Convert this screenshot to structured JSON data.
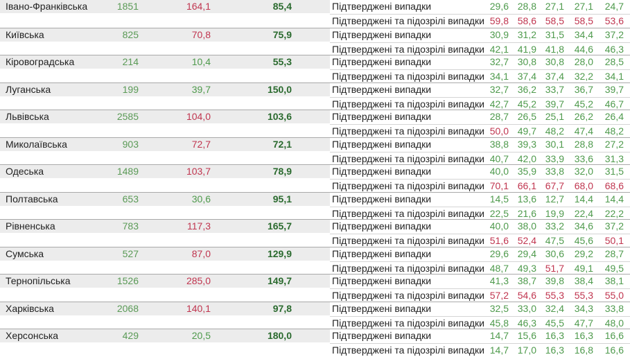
{
  "colors": {
    "green": "#4e9a4c",
    "red": "#c0354f",
    "bold_green": "#2a6a2e"
  },
  "rows": [
    {
      "name": "Івано-Франківська",
      "cases": "1851",
      "rate": "164,1",
      "rate_color": "red",
      "index": "85,4",
      "lines": [
        {
          "label": "Підтверджені випадки",
          "values": [
            "29,6",
            "28,8",
            "27,1",
            "27,1",
            "24,7"
          ],
          "color": "green"
        },
        {
          "label": "Підтверджені та підозрілі випадки",
          "values": [
            "59,8",
            "58,6",
            "58,5",
            "58,5",
            "53,6"
          ],
          "color": "red"
        }
      ]
    },
    {
      "name": "Київська",
      "cases": "825",
      "rate": "70,8",
      "rate_color": "red",
      "index": "75,9",
      "lines": [
        {
          "label": "Підтверджені випадки",
          "values": [
            "30,9",
            "31,2",
            "31,5",
            "34,4",
            "37,2"
          ],
          "color": "green"
        },
        {
          "label": "Підтверджені та підозрілі випадки",
          "values": [
            "42,1",
            "41,9",
            "41,8",
            "44,6",
            "46,3"
          ],
          "color": "green"
        }
      ]
    },
    {
      "name": "Кіровоградська",
      "cases": "214",
      "rate": "10,4",
      "rate_color": "green",
      "index": "55,3",
      "lines": [
        {
          "label": "Підтверджені випадки",
          "values": [
            "32,7",
            "30,8",
            "30,8",
            "28,0",
            "28,5"
          ],
          "color": "green"
        },
        {
          "label": "Підтверджені та підозрілі випадки",
          "values": [
            "34,1",
            "37,4",
            "37,4",
            "32,2",
            "34,1"
          ],
          "color": "green"
        }
      ]
    },
    {
      "name": "Луганська",
      "cases": "199",
      "rate": "39,7",
      "rate_color": "green",
      "index": "150,0",
      "lines": [
        {
          "label": "Підтверджені випадки",
          "values": [
            "32,7",
            "36,2",
            "33,7",
            "36,7",
            "39,7"
          ],
          "color": "green"
        },
        {
          "label": "Підтверджені та підозрілі випадки",
          "values": [
            "42,7",
            "45,2",
            "39,7",
            "45,2",
            "46,7"
          ],
          "color": "green"
        }
      ]
    },
    {
      "name": "Львівська",
      "cases": "2585",
      "rate": "104,0",
      "rate_color": "red",
      "index": "103,6",
      "lines": [
        {
          "label": "Підтверджені випадки",
          "values": [
            "28,7",
            "26,5",
            "25,1",
            "26,2",
            "26,4"
          ],
          "color": "green"
        },
        {
          "label": "Підтверджені та підозрілі випадки",
          "values": [
            "50,0",
            "49,7",
            "48,2",
            "47,4",
            "48,2"
          ],
          "color": "mixed",
          "colors": [
            "red",
            "green",
            "green",
            "green",
            "green"
          ]
        }
      ]
    },
    {
      "name": "Миколаївська",
      "cases": "903",
      "rate": "72,7",
      "rate_color": "red",
      "index": "72,1",
      "lines": [
        {
          "label": "Підтверджені випадки",
          "values": [
            "38,8",
            "39,3",
            "30,1",
            "28,8",
            "27,2"
          ],
          "color": "green"
        },
        {
          "label": "Підтверджені та підозрілі випадки",
          "values": [
            "40,7",
            "42,0",
            "33,9",
            "33,6",
            "31,3"
          ],
          "color": "green"
        }
      ]
    },
    {
      "name": "Одеська",
      "cases": "1489",
      "rate": "103,7",
      "rate_color": "red",
      "index": "78,9",
      "lines": [
        {
          "label": "Підтверджені випадки",
          "values": [
            "40,0",
            "35,9",
            "33,8",
            "32,0",
            "31,5"
          ],
          "color": "green"
        },
        {
          "label": "Підтверджені та підозрілі випадки",
          "values": [
            "70,1",
            "66,1",
            "67,7",
            "68,0",
            "68,6"
          ],
          "color": "red"
        }
      ]
    },
    {
      "name": "Полтавська",
      "cases": "653",
      "rate": "30,6",
      "rate_color": "green",
      "index": "95,1",
      "lines": [
        {
          "label": "Підтверджені випадки",
          "values": [
            "14,5",
            "13,6",
            "12,7",
            "14,4",
            "14,4"
          ],
          "color": "green"
        },
        {
          "label": "Підтверджені та підозрілі випадки",
          "values": [
            "22,5",
            "21,6",
            "19,9",
            "22,4",
            "22,2"
          ],
          "color": "green"
        }
      ]
    },
    {
      "name": "Рівненська",
      "cases": "783",
      "rate": "117,3",
      "rate_color": "red",
      "index": "165,7",
      "lines": [
        {
          "label": "Підтверджені випадки",
          "values": [
            "40,0",
            "38,0",
            "33,2",
            "34,6",
            "37,2"
          ],
          "color": "green"
        },
        {
          "label": "Підтверджені та підозрілі випадки",
          "values": [
            "51,6",
            "52,4",
            "47,5",
            "45,6",
            "50,1"
          ],
          "color": "mixed",
          "colors": [
            "red",
            "red",
            "green",
            "green",
            "red"
          ]
        }
      ]
    },
    {
      "name": "Сумська",
      "cases": "527",
      "rate": "87,0",
      "rate_color": "red",
      "index": "129,9",
      "lines": [
        {
          "label": "Підтверджені випадки",
          "values": [
            "29,6",
            "29,4",
            "30,6",
            "29,2",
            "28,7"
          ],
          "color": "green"
        },
        {
          "label": "Підтверджені та підозрілі випадки",
          "values": [
            "48,7",
            "49,3",
            "51,7",
            "49,1",
            "49,5"
          ],
          "color": "mixed",
          "colors": [
            "green",
            "green",
            "red",
            "green",
            "green"
          ]
        }
      ]
    },
    {
      "name": "Тернопільська",
      "cases": "1526",
      "rate": "285,0",
      "rate_color": "red",
      "index": "149,7",
      "lines": [
        {
          "label": "Підтверджені випадки",
          "values": [
            "41,3",
            "38,7",
            "39,8",
            "38,4",
            "38,1"
          ],
          "color": "green"
        },
        {
          "label": "Підтверджені та підозрілі випадки",
          "values": [
            "57,2",
            "54,6",
            "55,3",
            "55,3",
            "55,0"
          ],
          "color": "red"
        }
      ]
    },
    {
      "name": "Харківська",
      "cases": "2068",
      "rate": "140,1",
      "rate_color": "red",
      "index": "97,8",
      "lines": [
        {
          "label": "Підтверджені випадки",
          "values": [
            "32,5",
            "33,0",
            "32,4",
            "34,3",
            "33,8"
          ],
          "color": "green"
        },
        {
          "label": "Підтверджені та підозрілі випадки",
          "values": [
            "45,8",
            "46,3",
            "45,5",
            "47,7",
            "48,0"
          ],
          "color": "green"
        }
      ]
    },
    {
      "name": "Херсонська",
      "cases": "429",
      "rate": "20,5",
      "rate_color": "green",
      "index": "180,0",
      "lines": [
        {
          "label": "Підтверджені випадки",
          "values": [
            "14,7",
            "15,6",
            "16,3",
            "16,3",
            "16,6"
          ],
          "color": "green"
        },
        {
          "label": "Підтверджені та підозрілі випадки",
          "values": [
            "14,7",
            "17,0",
            "16,3",
            "16,8",
            "16,6"
          ],
          "color": "green"
        }
      ]
    }
  ]
}
